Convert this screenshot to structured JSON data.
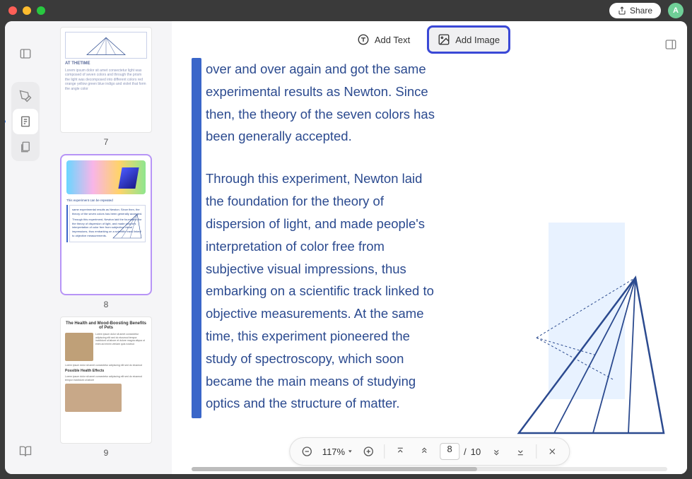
{
  "titlebar": {
    "share_label": "Share",
    "avatar_letter": "A"
  },
  "toolbar": {
    "add_text_label": "Add Text",
    "add_image_label": "Add Image"
  },
  "thumbnails": {
    "page7": {
      "label": "7",
      "heading": "AT THETIME"
    },
    "page8": {
      "label": "8",
      "caption": "This experiment can be repeated",
      "snippet": "same experimental results as Newton. Since then, the theory of the seven colors has been generally accepted."
    },
    "page9": {
      "label": "9",
      "title": "The Health and Mood-Boosting Benefits of Pets",
      "subhead": "Possible Health Effects"
    }
  },
  "document": {
    "para1": "over and over again and got the same experimental results as Newton. Since then, the theory of the seven colors has been generally accepted.",
    "para2": "Through this experiment, Newton laid the foundation for the theory of dispersion of light, and made people's interpretation of color free from subjective visual impressions, thus embarking on a scientific track linked to objective measurements. At the same time, this experiment pioneered the study of spectroscopy, which soon became the main means of studying optics and the structure of matter."
  },
  "bottombar": {
    "zoom_label": "117%",
    "current_page": "8",
    "page_sep": "/",
    "total_pages": "10"
  }
}
